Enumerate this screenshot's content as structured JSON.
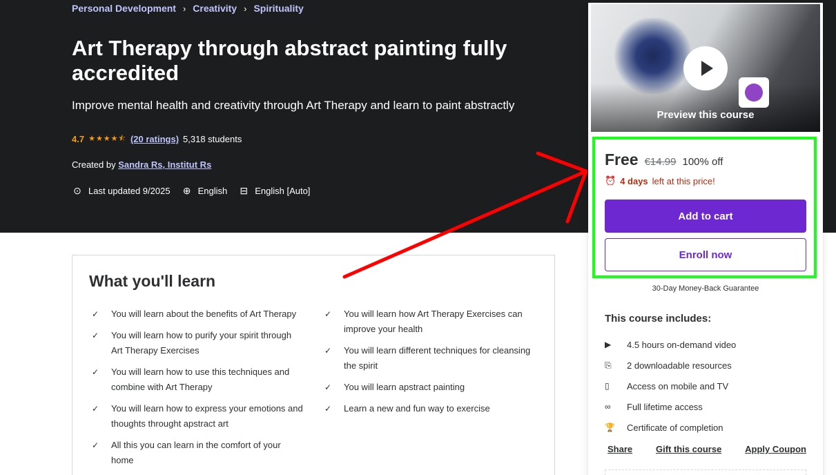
{
  "breadcrumb": [
    "Personal Development",
    "Creativity",
    "Spirituality"
  ],
  "course": {
    "title": "Art Therapy through abstract painting fully accredited",
    "subtitle": "Improve mental health and creativity through Art Therapy and learn to paint abstractly",
    "rating": "4.7",
    "stars": "★★★★⯪",
    "ratings_count": "(20 ratings)",
    "students": "5,318 students",
    "created_by_label": "Created by",
    "instructors": "Sandra Rs, Institut Rs",
    "last_updated": "Last updated 9/2025",
    "language": "English",
    "captions": "English [Auto]"
  },
  "learn": {
    "title": "What you'll learn",
    "left": [
      "You will learn about the benefits of Art Therapy",
      "You will learn how to purify your spirit through Art Therapy Exercises",
      "You will learn how to use this techniques and combine with Art Therapy",
      "You will learn how to express your emotions and thoughts throught apstract art",
      "All this you can learn in the comfort of your home"
    ],
    "right": [
      "You will learn how Art Therapy Exercises can improve your health",
      "You will learn different techniques for cleansing the spirit",
      "You will learn apstract painting",
      "Learn a new and fun way to exercise"
    ]
  },
  "sidebar": {
    "preview_label": "Preview this course",
    "price": "Free",
    "original_price": "€14.99",
    "discount": "100% off",
    "countdown_bold": "4 days",
    "countdown_rest": "left at this price!",
    "add_to_cart": "Add to cart",
    "enroll_now": "Enroll now",
    "guarantee": "30-Day Money-Back Guarantee",
    "includes_title": "This course includes:",
    "includes": [
      {
        "icon": "video-icon",
        "text": "4.5 hours on-demand video"
      },
      {
        "icon": "file-download-icon",
        "text": "2 downloadable resources"
      },
      {
        "icon": "mobile-icon",
        "text": "Access on mobile and TV"
      },
      {
        "icon": "infinity-icon",
        "text": "Full lifetime access"
      },
      {
        "icon": "trophy-icon",
        "text": "Certificate of completion"
      }
    ],
    "share": "Share",
    "gift": "Gift this course",
    "apply_coupon": "Apply Coupon"
  },
  "colors": {
    "hero_bg": "#1c1d1f",
    "accent_purple": "#6d28d2",
    "link_lavender": "#c0c4fc",
    "star_orange": "#f69c08",
    "highlight_green": "#1aff1a",
    "arrow_red": "#ff0000"
  }
}
